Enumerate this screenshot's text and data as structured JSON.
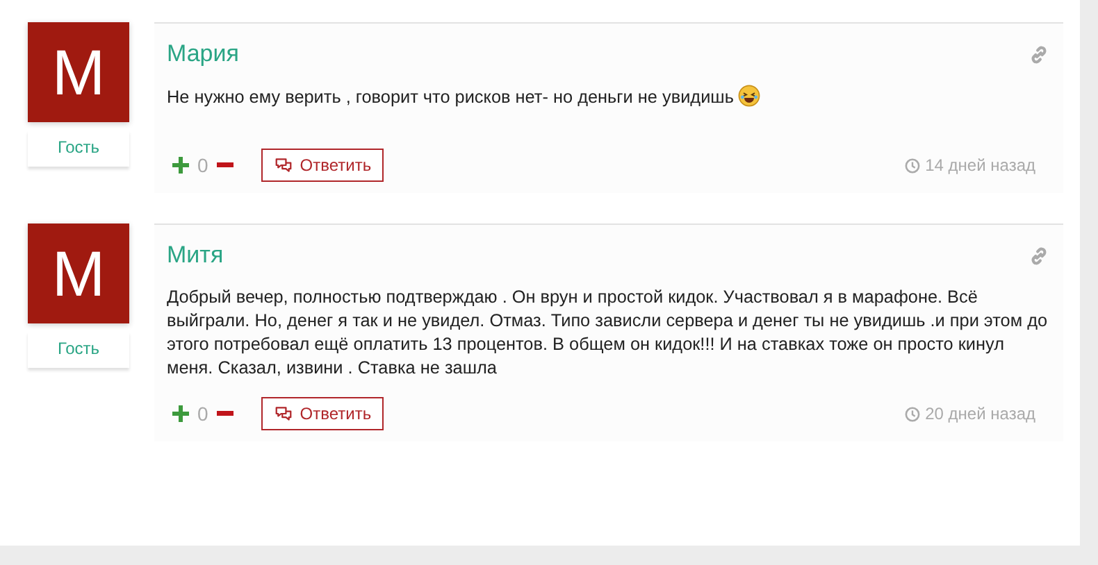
{
  "comments": [
    {
      "avatar_letter": "M",
      "author": "Мария",
      "role": "Гость",
      "text": "Не нужно ему верить , говорит что рисков нет- но деньги не увидишь",
      "emoji": true,
      "score": "0",
      "reply": "Ответить",
      "time": "14 дней назад"
    },
    {
      "avatar_letter": "M",
      "author": "Митя",
      "role": "Гость",
      "text": "Добрый вечер, полностью подтверждаю . Он врун и простой кидок. Участвовал я в марафоне. Всё выйграли. Но, денег я так и не увидел. Отмаз. Типо зависли сервера и денег ты не увидишь .и при этом до этого потребовал ещё оплатить 13 процентов. В общем он кидок!!! И на ставках тоже он просто кинул меня. Сказал, извини . Ставка не зашла",
      "emoji": false,
      "score": "0",
      "reply": "Ответить",
      "time": "20 дней назад"
    }
  ]
}
